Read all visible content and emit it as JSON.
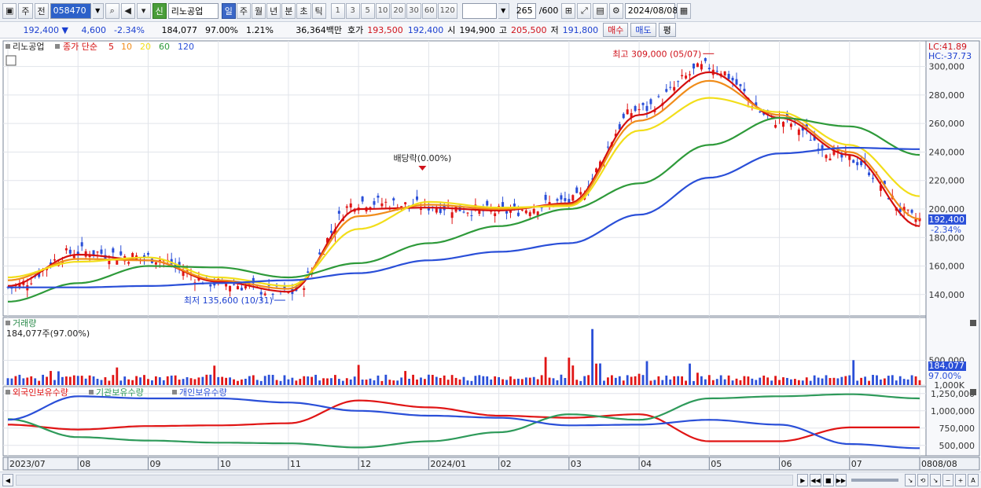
{
  "toolbar": {
    "market_type": "주",
    "prev_label": "전",
    "code": "058470",
    "shin_badge": "신",
    "stock_name": "리노공업",
    "periods": [
      "일",
      "주",
      "월",
      "년",
      "분",
      "초",
      "틱"
    ],
    "active_period": "일",
    "intervals": [
      "1",
      "3",
      "5",
      "10",
      "20",
      "30",
      "60",
      "120"
    ],
    "count": "265",
    "count_total": "/600",
    "date": "2024/08/08"
  },
  "quote": {
    "price": "192,400",
    "change": "4,600",
    "change_pct": "-2.34%",
    "volume": "184,077",
    "volume_pct": "97.00%",
    "turnover_pct": "1.21%",
    "amount": "36,364백만",
    "bid_label": "호가",
    "ask": "193,500",
    "bid": "192,400",
    "open_label": "시",
    "open": "194,900",
    "high_label": "고",
    "high": "205,500",
    "low_label": "저",
    "low": "191,800",
    "buy_label": "매수",
    "sell_label": "매도",
    "eval_label": "평"
  },
  "price_panel": {
    "legend": {
      "name": "리노공업",
      "series_label": "종가 단순",
      "ma_labels": [
        "5",
        "10",
        "20",
        "60",
        "120"
      ],
      "ma_colors": [
        "#d40e0e",
        "#f08c1a",
        "#f2de1a",
        "#2e9a3a",
        "#2a4fd8"
      ]
    },
    "lc": "LC:41.89",
    "hc": "HC:-37.73",
    "y_ticks": [
      "300,000",
      "280,000",
      "260,000",
      "240,000",
      "220,000",
      "200,000",
      "180,000",
      "160,000",
      "140,000"
    ],
    "last_price_box": "192,400",
    "last_change_box": "-2.34%",
    "annotations": {
      "high": "최고 309,000 (05/07)",
      "low": "최저 135,600 (10/31)",
      "dividend": "배당락(0.00%)"
    }
  },
  "volume_panel": {
    "title": "거래량",
    "value": "184,077주(97.00%)",
    "y_ticks": [
      "1,000K",
      "500,000"
    ],
    "last_box": "184,077",
    "last_pct": "97.00%"
  },
  "holdings_panel": {
    "legend": [
      "외국인보유수량",
      "기관보유수량",
      "개인보유수량"
    ],
    "colors": [
      "#e01515",
      "#2e9a5a",
      "#2a4fd8"
    ],
    "y_ticks": [
      "1,250,000",
      "1,000,000",
      "750,000",
      "500,000"
    ]
  },
  "x_axis": {
    "labels": [
      "2023/07",
      "08",
      "09",
      "10",
      "11",
      "12",
      "2024/01",
      "02",
      "03",
      "04",
      "05",
      "06",
      "07",
      "08"
    ],
    "right_label": "08/08"
  },
  "chart_data": {
    "type": "line",
    "title": "",
    "x": [
      "2023/07",
      "08",
      "09",
      "10",
      "11",
      "12",
      "2024/01",
      "02",
      "03",
      "04",
      "05",
      "06",
      "07",
      "08"
    ],
    "ylim": [
      125000,
      318000
    ],
    "series": [
      {
        "name": "종가",
        "values": [
          145000,
          170000,
          166000,
          148000,
          141000,
          205000,
          202000,
          198000,
          205000,
          270000,
          300000,
          262000,
          235000,
          192400
        ]
      },
      {
        "name": "5",
        "values": [
          146000,
          168000,
          164000,
          149000,
          142000,
          200000,
          201000,
          199000,
          204000,
          266000,
          296000,
          264000,
          238000,
          188000
        ]
      },
      {
        "name": "10",
        "values": [
          150000,
          165000,
          164000,
          150000,
          144000,
          195000,
          203000,
          200000,
          203000,
          262000,
          290000,
          266000,
          240000,
          193000
        ]
      },
      {
        "name": "20",
        "values": [
          152000,
          163000,
          166000,
          152000,
          146000,
          186000,
          205000,
          201000,
          202000,
          255000,
          278000,
          268000,
          245000,
          209000
        ]
      },
      {
        "name": "60",
        "values": [
          135000,
          148000,
          160000,
          159000,
          152000,
          162000,
          176000,
          188000,
          200000,
          218000,
          245000,
          264000,
          258000,
          238000
        ]
      },
      {
        "name": "120",
        "values": [
          145000,
          145000,
          146000,
          148000,
          150000,
          155000,
          164000,
          170000,
          176000,
          196000,
          222000,
          239000,
          243000,
          242000
        ]
      }
    ],
    "holdings": [
      {
        "name": "외국인보유수량",
        "values": [
          800000,
          730000,
          780000,
          790000,
          820000,
          1150000,
          1050000,
          930000,
          900000,
          950000,
          560000,
          560000,
          760000,
          760000
        ]
      },
      {
        "name": "기관보유수량",
        "values": [
          880000,
          620000,
          570000,
          540000,
          530000,
          470000,
          560000,
          690000,
          950000,
          870000,
          1180000,
          1210000,
          1240000,
          1180000
        ]
      },
      {
        "name": "개인보유수량",
        "values": [
          870000,
          1210000,
          1180000,
          1180000,
          1120000,
          1000000,
          930000,
          900000,
          790000,
          800000,
          870000,
          800000,
          520000,
          460000
        ]
      }
    ]
  }
}
